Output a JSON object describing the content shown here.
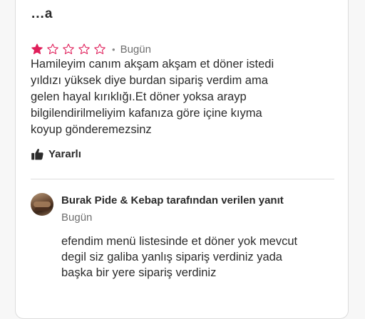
{
  "review": {
    "author": "...a",
    "rating": 1,
    "max_rating": 5,
    "star_filled_color": "#e01e5a",
    "star_empty_color": "#e01e5a",
    "separator": "•",
    "date": "Bugün",
    "lines": [
      "Hamileyim canım akşam akşam et döner istedi",
      "yıldızı yüksek diye burdan sipariş verdim ama",
      "gelen hayal kırıklığı.Et döner yoksa arayp",
      "bilgilendirilmeliyim kafanıza göre içine kıyma",
      "koyup gönderemezsinz"
    ],
    "helpful_label": "Yararlı",
    "helpful_icon": "thumbs-up-icon"
  },
  "owner_reply": {
    "name": "Burak Pide & Kebap tarafından verilen yanıt",
    "date": "Bugün",
    "avatar_icon": "restaurant-avatar",
    "lines": [
      "efendim menü listesinde et döner yok mevcut",
      "degil siz galiba yanlış sipariş verdiniz yada",
      "başka bir yere sipariş verdiniz"
    ]
  }
}
